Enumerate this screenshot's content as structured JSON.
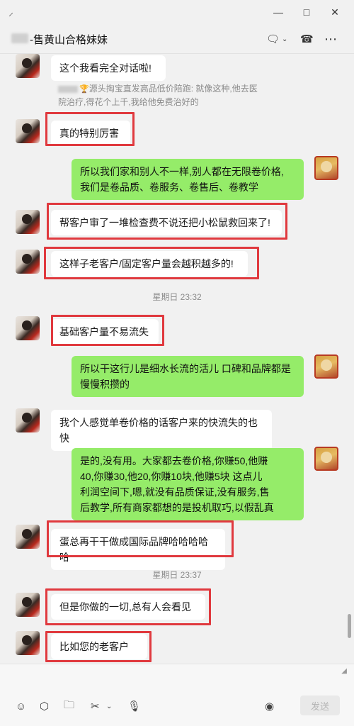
{
  "window": {
    "pin_icon": "pin-icon",
    "minimize_icon": "minimize-icon",
    "maximize_icon": "maximize-icon",
    "close_icon": "close-icon"
  },
  "header": {
    "title": "-售黄山合格妹妹",
    "icons": [
      "chat-icon",
      "phone-icon",
      "more-icon"
    ]
  },
  "messages": [
    {
      "side": "left",
      "text": "这个我看完全对话啦!",
      "highlighted": false
    },
    {
      "side": "quote",
      "text_line1": "源头掏宝直发高品低价陪跑: 就像这种,他去医",
      "text_line2": "院治疗,得花个上千,我给他免费治好的"
    },
    {
      "side": "left",
      "text": "真的特别厉害",
      "highlighted": true
    },
    {
      "side": "right",
      "text": "所以我们家和别人不一样,别人都在无限卷价格,\n我们是卷品质、卷服务、卷售后、卷教学",
      "highlighted": false
    },
    {
      "side": "left",
      "text": "帮客户审了一堆检查费不说还把小松鼠救回来了!",
      "highlighted": true
    },
    {
      "side": "left",
      "text": "这样子老客户/固定客户量会越积越多的!",
      "highlighted": true
    },
    {
      "side": "time",
      "text": "星期日 23:32"
    },
    {
      "side": "left",
      "text": "基础客户量不易流失",
      "highlighted": true
    },
    {
      "side": "right",
      "text": "所以干这行儿是细水长流的活儿  口碑和品牌都是\n慢慢积攒的",
      "highlighted": false
    },
    {
      "side": "left",
      "text": "我个人感觉单卷价格的话客户来的快流失的也快",
      "highlighted": false
    },
    {
      "side": "right",
      "text": "是的,没有用。大家都去卷价格,你赚50,他赚\n40,你赚30,他20,你赚10块,他赚5块  这点儿\n利润空间下,嗯,就没有品质保证,没有服务,售\n后教学,所有商家都想的是投机取巧,以假乱真",
      "highlighted": false
    },
    {
      "side": "left",
      "text": "蛋总再干干做成国际品牌哈哈哈哈哈",
      "highlighted": true
    },
    {
      "side": "time",
      "text": "星期日 23:37"
    },
    {
      "side": "left",
      "text": "但是你做的一切,总有人会看见",
      "highlighted": true
    },
    {
      "side": "left",
      "text": "比如您的老客户",
      "highlighted": true
    }
  ],
  "toolbar": {
    "icons": [
      "emoji-icon",
      "box-icon",
      "folder-icon",
      "scissors-icon",
      "microphone-icon",
      "voice-call-icon"
    ],
    "send_label": "发送"
  },
  "colors": {
    "background": "#f1f1f1",
    "bubble_left": "#ffffff",
    "bubble_right": "#95ec69",
    "highlight_box": "#e0393e"
  }
}
